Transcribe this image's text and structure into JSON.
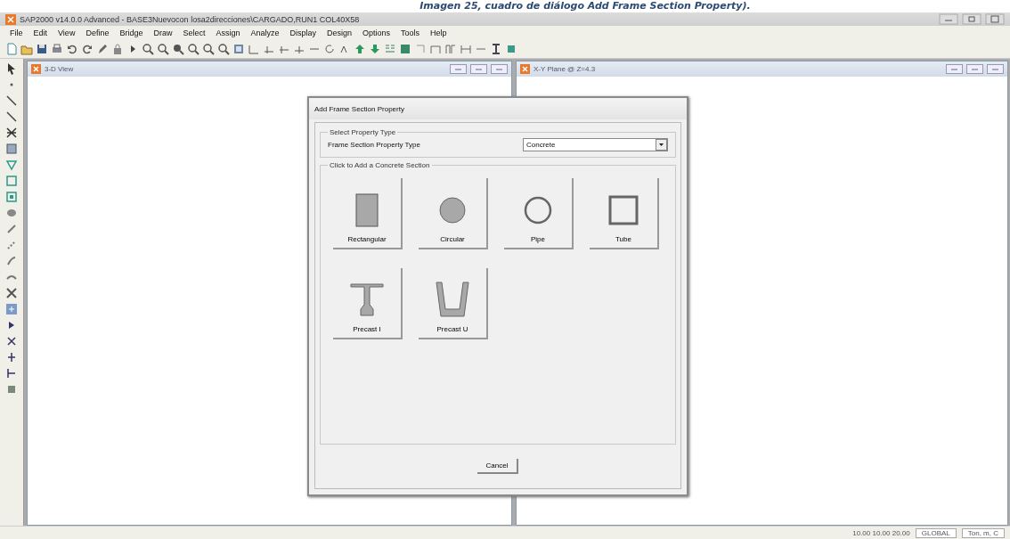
{
  "caption": "Imagen 25, cuadro de diálogo Add Frame Section Property).",
  "window": {
    "title": "SAP2000 v14.0.0 Advanced  -  BASE3Nuevocon losa2direcciones\\CARGADO,RUN1 COL40X58"
  },
  "menu": [
    "File",
    "Edit",
    "View",
    "Define",
    "Bridge",
    "Draw",
    "Select",
    "Assign",
    "Analyze",
    "Display",
    "Design",
    "Options",
    "Tools",
    "Help"
  ],
  "views": [
    {
      "title": "3-D View"
    },
    {
      "title": "X-Y Plane @ Z=4.3"
    }
  ],
  "dialog": {
    "title": "Add Frame Section Property",
    "type_group": {
      "legend": "Select Property Type",
      "label": "Frame Section Property Type",
      "value": "Concrete"
    },
    "sections_group": {
      "legend": "Click to Add a Concrete Section",
      "sections": [
        {
          "label": "Rectangular",
          "kind": "rectangular"
        },
        {
          "label": "Circular",
          "kind": "circular"
        },
        {
          "label": "Pipe",
          "kind": "pipe"
        },
        {
          "label": "Tube",
          "kind": "tube"
        },
        {
          "label": "Precast I",
          "kind": "precasti"
        },
        {
          "label": "Precast U",
          "kind": "precastu"
        }
      ]
    },
    "buttons": [
      "Cancel"
    ]
  },
  "status_bar": {
    "coordinates": "10.00  10.00  20.00",
    "coord_system": "GLOBAL",
    "units": "Ton, m, C"
  }
}
